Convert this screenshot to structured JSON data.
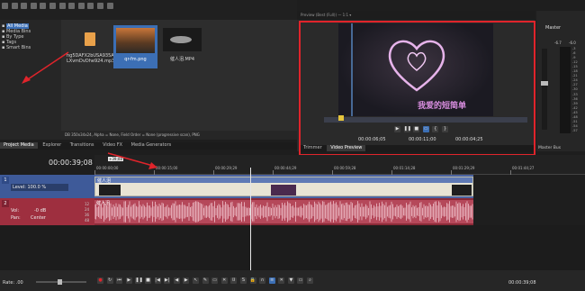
{
  "toolbar": {
    "timecode": "00:00:39;08",
    "timecode_small": "00:00:39;08",
    "rate": "Rate: .00"
  },
  "media_tree": {
    "items": [
      {
        "label": "All Media",
        "selected": true
      },
      {
        "label": "Media Bins",
        "selected": false
      },
      {
        "label": "By Type",
        "selected": false
      },
      {
        "label": "Tags",
        "selected": false
      },
      {
        "label": "Smart Bins",
        "selected": false
      }
    ]
  },
  "media_items": [
    {
      "name": "hg5DAFX2bUSA935A\nLXvmDvDhe924.mp3",
      "icon": "audio-file-icon"
    },
    {
      "name": "qr-fm.png",
      "icon": "image-thumbnail"
    },
    {
      "name": "催人泪.MP4",
      "icon": "video-thumbnail"
    }
  ],
  "media_status": "DB 350x34x24, Alpha = None, Field Order = None (progressive scan), PNG",
  "bottom_tabs": [
    "Project Media",
    "Explorer",
    "Transitions",
    "Video FX",
    "Media Generators"
  ],
  "preview": {
    "title_text": "Preview (Best (Full)) — 1:1 ▾",
    "caption": "我爱的短简单",
    "time_in": "00:00:06;05",
    "time_cur": "00:00:11;00",
    "time_len": "00:00:04;25",
    "tabs": [
      "Trimmer",
      "Video Preview"
    ]
  },
  "master": {
    "label": "Master",
    "value_left": "-6.7",
    "value_right": "-6.0",
    "bus_label": "Master Bus",
    "scale": [
      "-3",
      "-6",
      "-9",
      "-12",
      "-15",
      "-18",
      "-21",
      "-24",
      "-27",
      "-30",
      "-33",
      "-36",
      "-39",
      "-42",
      "-45",
      "-48",
      "-51",
      "-54",
      "-57"
    ]
  },
  "ruler": {
    "marks": [
      "00:00:00;00",
      "00:00:15;00",
      "00:00:29;29",
      "00:00:44;29",
      "00:00:59;28",
      "00:01:14;28",
      "00:01:29;29",
      "00:01:44;27"
    ],
    "marker_label": "+39;08"
  },
  "video_track": {
    "level": "Level: 100.0 %",
    "clip_label": "催人泪"
  },
  "audio_track": {
    "vol_label": "Vol:",
    "vol_value": "-0 dB",
    "pan_label": "Pan:",
    "pan_value": "Center",
    "clip_label": "催人泪",
    "num1": "12",
    "num2": "24",
    "num3": "36",
    "num4": "48"
  },
  "colors": {
    "highlight_red": "#e0242b",
    "video_track": "#3e5a99",
    "audio_track": "#9e2f3f"
  }
}
